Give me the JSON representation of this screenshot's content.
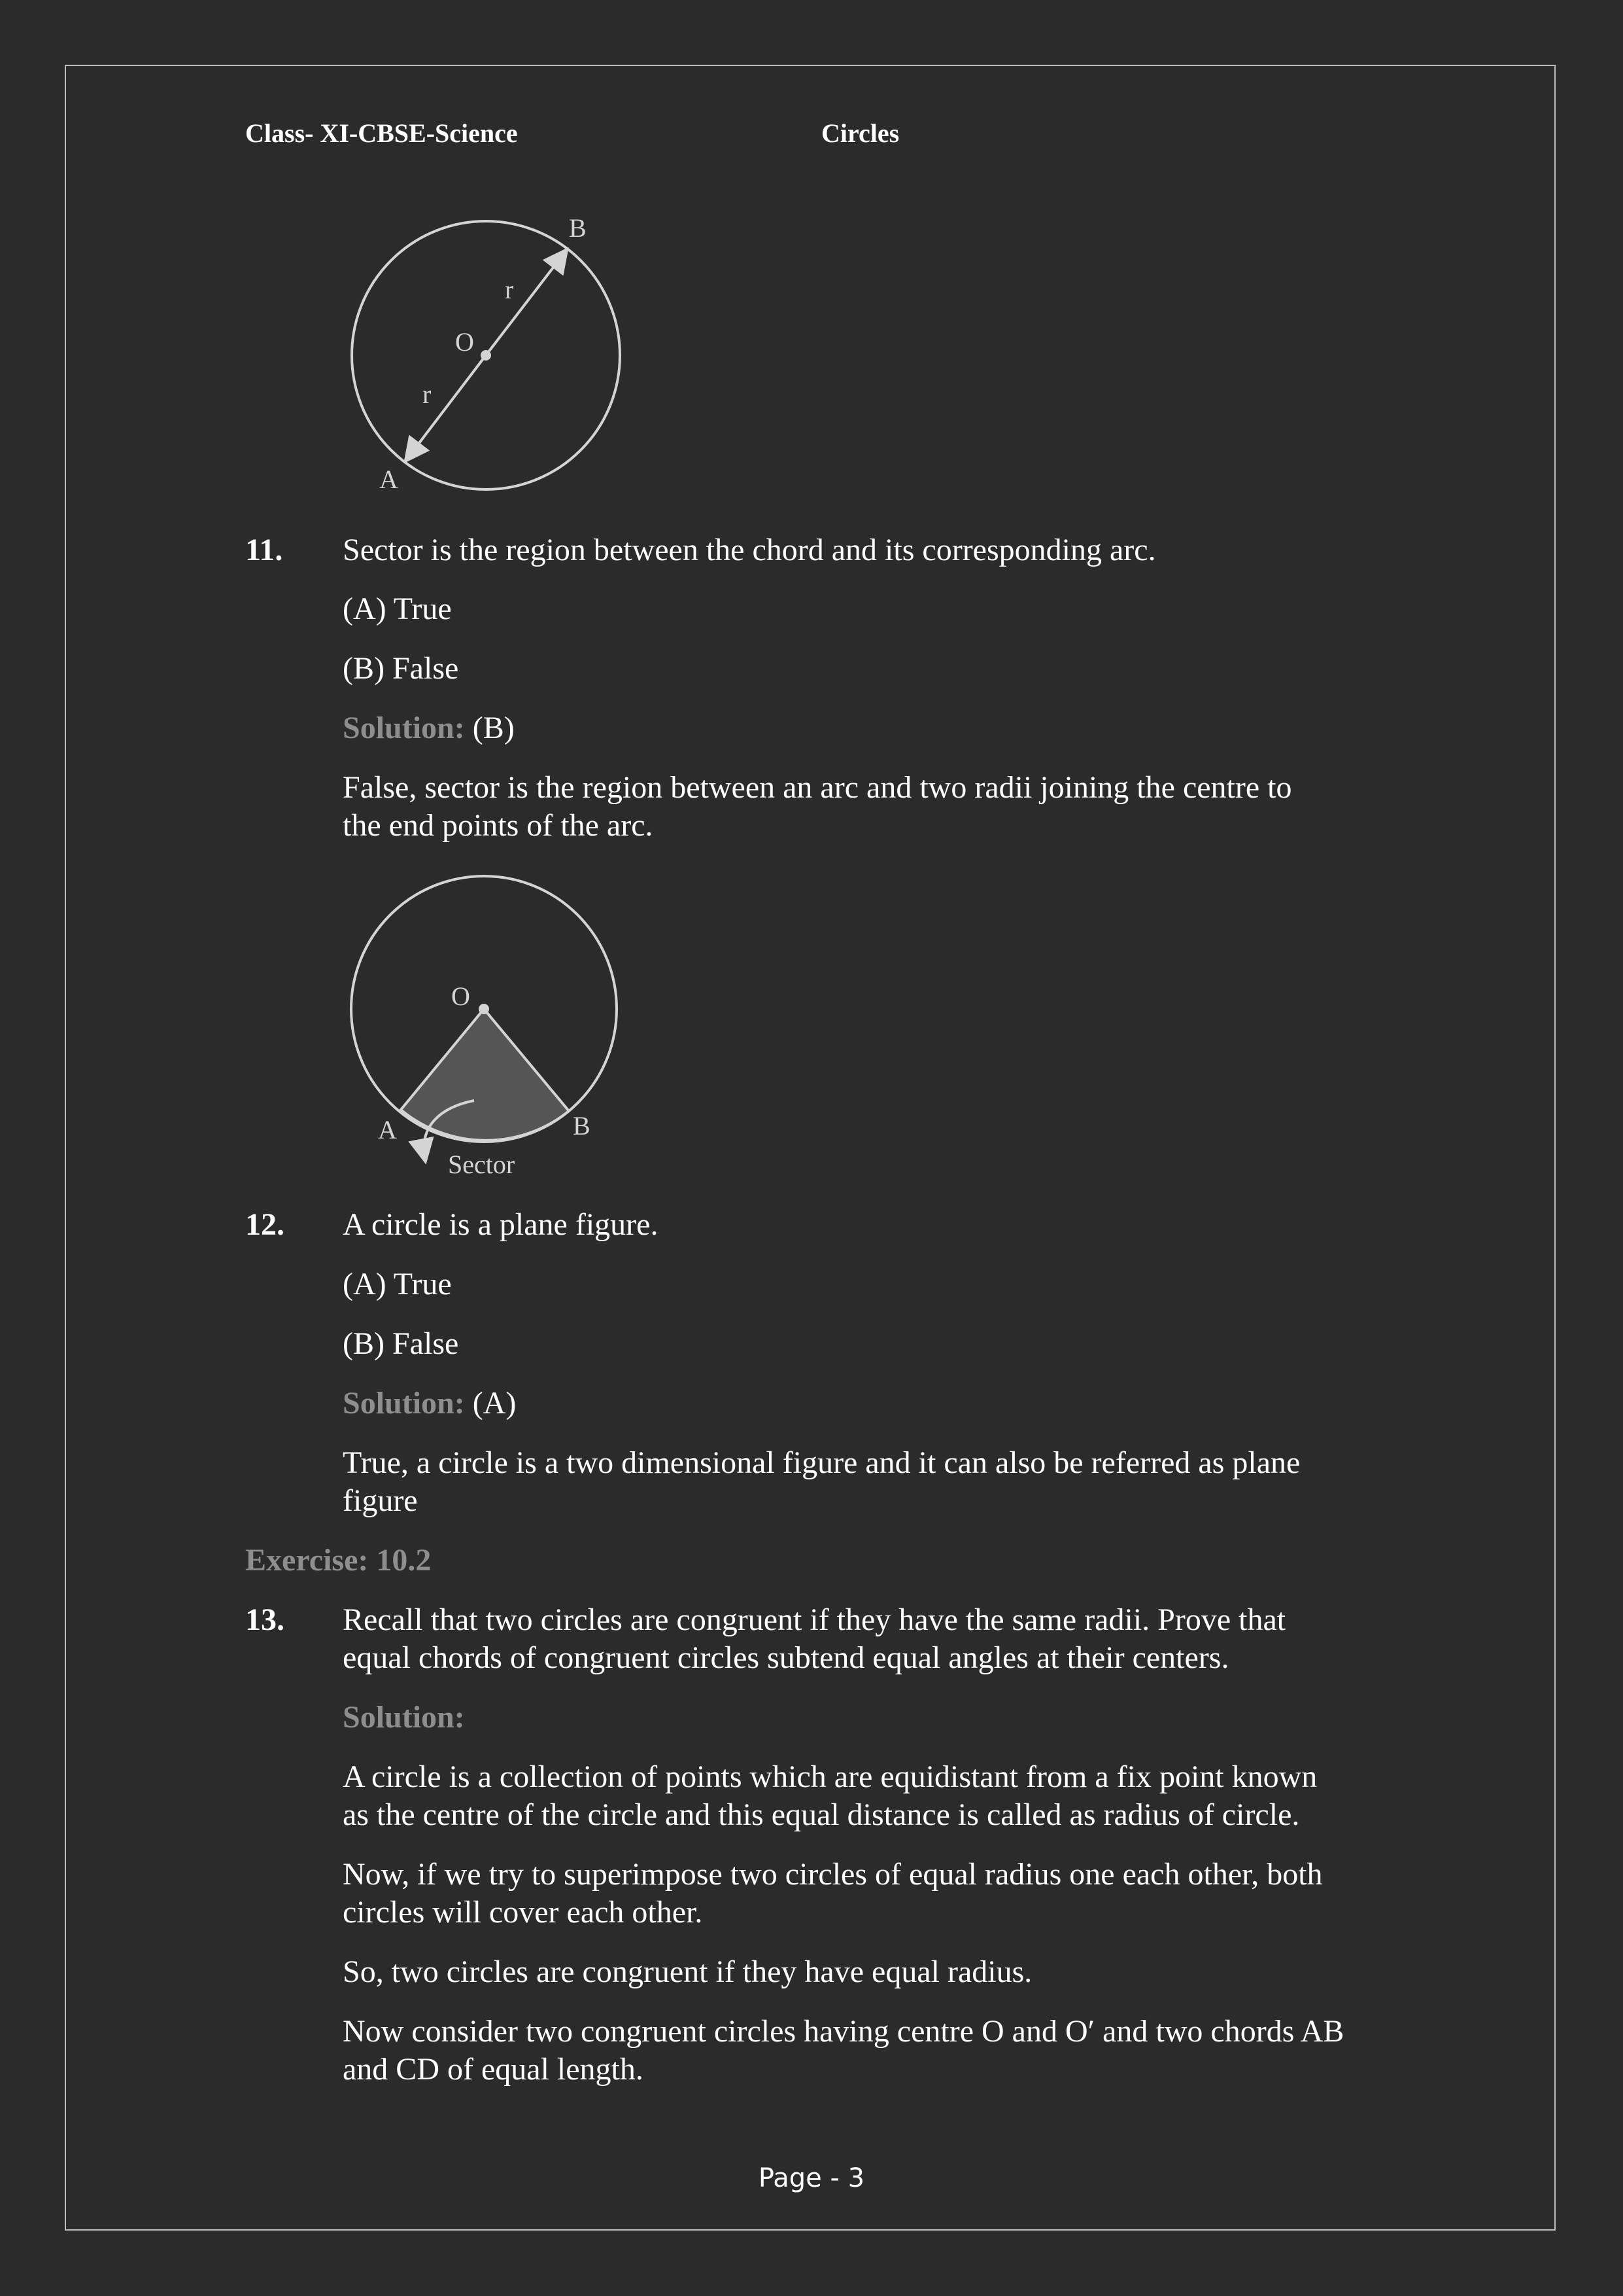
{
  "header": {
    "class_label": "Class- XI-CBSE-Science",
    "chapter": "Circles"
  },
  "fig1": {
    "labels": {
      "b": "B",
      "r_top": "r",
      "o": "O",
      "r_bottom": "r",
      "a": "A"
    }
  },
  "q11": {
    "number": "11.",
    "question": "Sector is the region between the chord and its corresponding arc.",
    "option_a": "(A) True",
    "option_b": "(B) False",
    "solution_label": "Solution:",
    "solution_answer": " (B)",
    "explanation_line1": "False, sector is the region between an arc and two radii joining the centre to",
    "explanation_line2": "the end points of the arc."
  },
  "fig2": {
    "labels": {
      "o": "O",
      "a": "A",
      "b": "B",
      "sector": "Sector"
    }
  },
  "q12": {
    "number": "12.",
    "question": "A circle is a plane figure.",
    "option_a": "(A) True",
    "option_b": "(B) False",
    "solution_label": "Solution:",
    "solution_answer": " (A)",
    "explanation_line1": "True, a circle is a two dimensional figure and it can also be referred as plane",
    "explanation_line2": "figure"
  },
  "exercise_heading": "Exercise: 10.2",
  "q13": {
    "number": "13.",
    "question_line1": "Recall that two circles are congruent if they have the same radii. Prove that",
    "question_line2": "equal chords of congruent circles subtend equal angles at their centers.",
    "solution_label": "Solution:",
    "p1_line1": "A circle is a collection of points which are equidistant from a fix point known",
    "p1_line2": "as the centre of the circle and this equal distance is called as radius of circle.",
    "p2_line1": "Now, if we try to superimpose two circles of equal radius one each other, both",
    "p2_line2": "circles will cover each other.",
    "p3": "So, two circles are congruent if they have equal radius.",
    "p4_line1": "Now consider two congruent circles having centre O and O′ and two chords AB",
    "p4_line2": "and CD of equal length."
  },
  "footer": {
    "page_label": "Page - 3"
  }
}
